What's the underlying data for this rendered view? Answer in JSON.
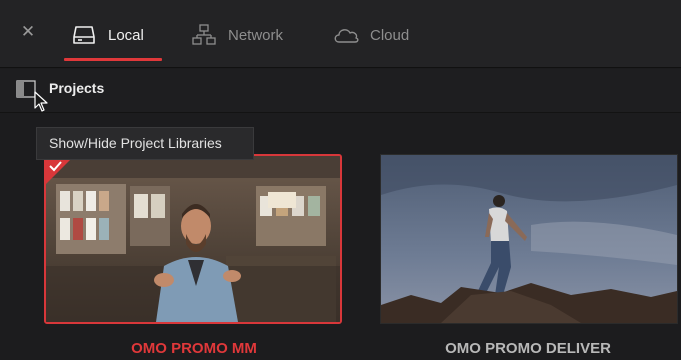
{
  "tabs": [
    {
      "label": "Local",
      "icon": "hard-drive-icon",
      "active": true
    },
    {
      "label": "Network",
      "icon": "network-icon",
      "active": false
    },
    {
      "label": "Cloud",
      "icon": "cloud-icon",
      "active": false
    }
  ],
  "projects_bar": {
    "label": "Projects",
    "toggle_icon": "sidebar-toggle-icon"
  },
  "tooltip": {
    "text": "Show/Hide Project Libraries"
  },
  "projects": [
    {
      "title": "OMO PROMO MM",
      "selected": true
    },
    {
      "title": "OMO PROMO DELIVER",
      "selected": false
    }
  ],
  "colors": {
    "accent": "#e0383a",
    "background": "#1c1c1e",
    "topbar": "#232325"
  }
}
